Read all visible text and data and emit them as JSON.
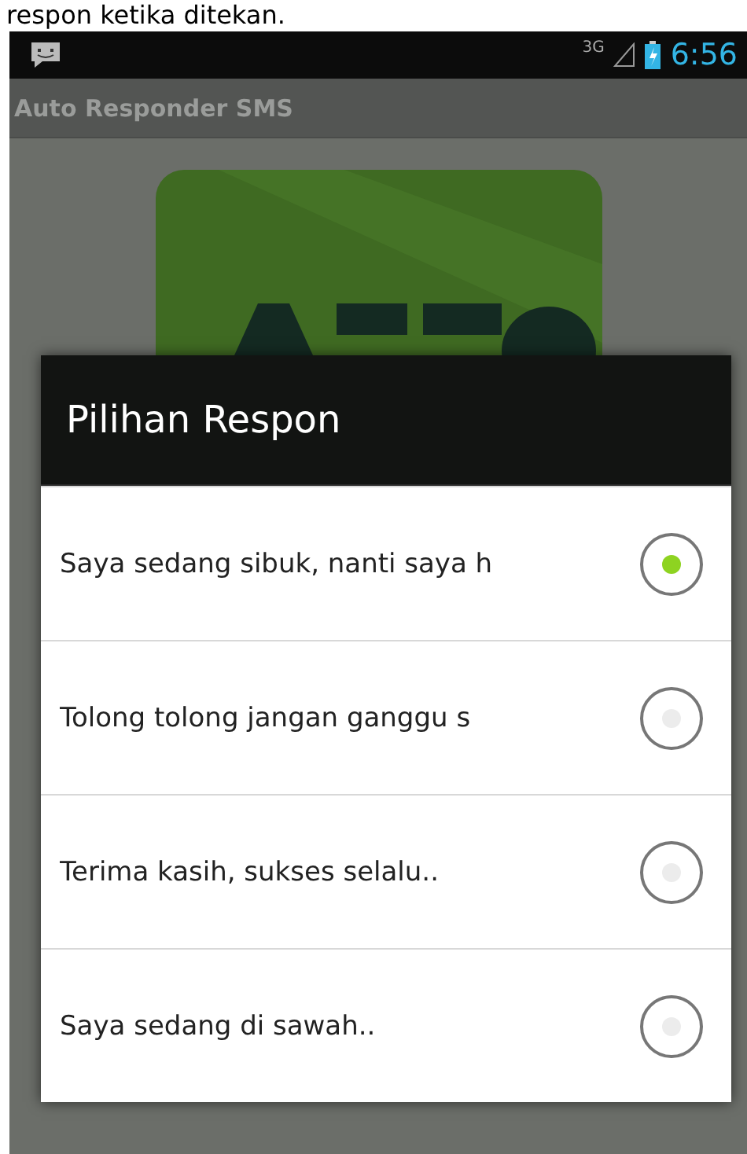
{
  "page_caption": "respon ketika ditekan.",
  "status_bar": {
    "network": "3G",
    "time": "6:56"
  },
  "app": {
    "title": "Auto Responder SMS"
  },
  "dialog": {
    "title": "Pilihan Respon",
    "options": [
      {
        "label": "Saya sedang sibuk, nanti saya h",
        "selected": true
      },
      {
        "label": "Tolong tolong jangan ganggu s",
        "selected": false
      },
      {
        "label": "Terima kasih, sukses selalu..",
        "selected": false
      },
      {
        "label": "Saya sedang di sawah..",
        "selected": false
      }
    ]
  }
}
